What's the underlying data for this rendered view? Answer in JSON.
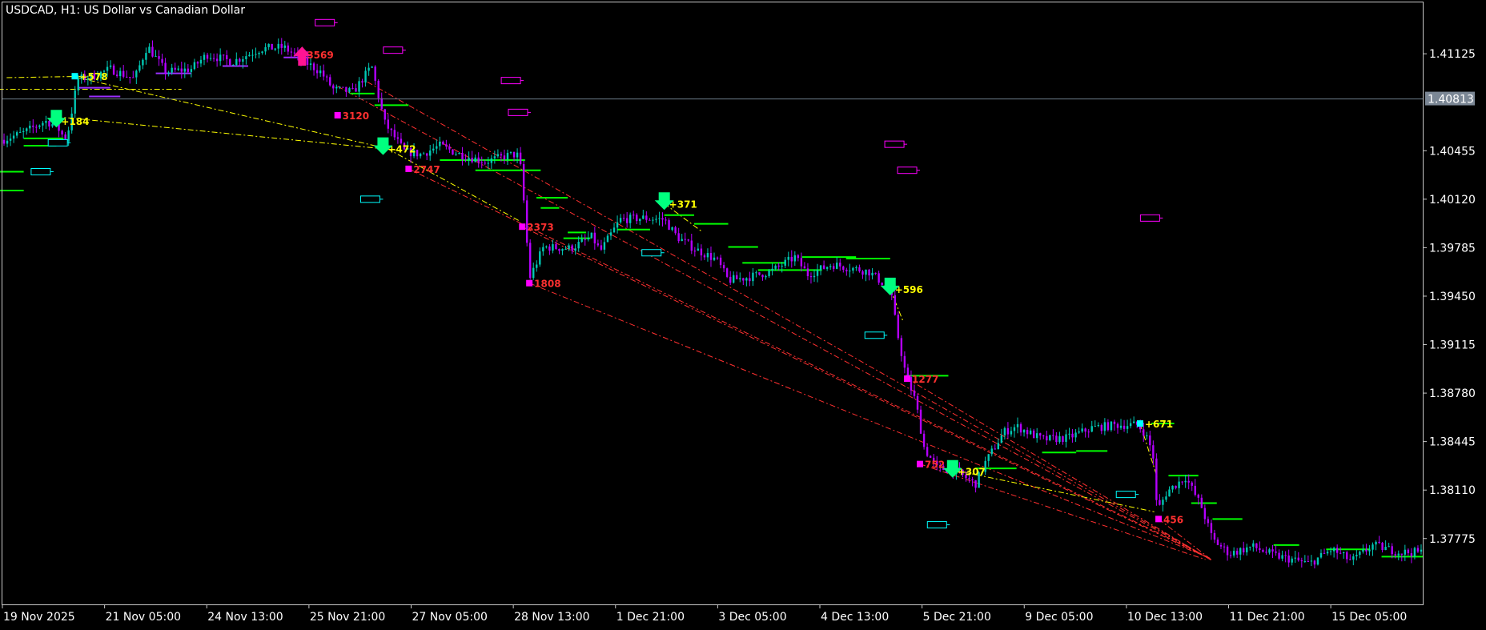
{
  "chart_data": {
    "type": "candlestick",
    "title": "USDCAD, H1:  US Dollar vs Canadian Dollar",
    "symbol": "USDCAD",
    "timeframe": "H1",
    "description": "US Dollar vs Canadian Dollar",
    "ylim": [
      1.3732,
      1.4148
    ],
    "grid": false,
    "current_price": "1.40813",
    "y_ticks": [
      "1.41125",
      "1.40455",
      "1.40120",
      "1.39785",
      "1.39450",
      "1.39115",
      "1.38780",
      "1.38445",
      "1.38110",
      "1.37775"
    ],
    "x_ticks": [
      "19 Nov 2025",
      "21 Nov 05:00",
      "24 Nov 13:00",
      "25 Nov 21:00",
      "27 Nov 05:00",
      "28 Nov 13:00",
      "1 Dec 21:00",
      "3 Dec 05:00",
      "4 Dec 13:00",
      "5 Dec 21:00",
      "9 Dec 05:00",
      "10 Dec 13:00",
      "11 Dec 21:00",
      "15 Dec 05:00"
    ],
    "x_range": [
      0,
      100
    ],
    "price_path": [
      [
        0,
        1.4053
      ],
      [
        1.5,
        1.4058
      ],
      [
        3,
        1.4066
      ],
      [
        3.8,
        1.4063
      ],
      [
        4.5,
        1.4052
      ],
      [
        5.3,
        1.4095
      ],
      [
        6.4,
        1.4097
      ],
      [
        7.6,
        1.4102
      ],
      [
        9.3,
        1.4095
      ],
      [
        10.2,
        1.4118
      ],
      [
        11.5,
        1.41
      ],
      [
        13.3,
        1.4102
      ],
      [
        14.4,
        1.4112
      ],
      [
        16.2,
        1.4107
      ],
      [
        18.2,
        1.4116
      ],
      [
        19.8,
        1.4117
      ],
      [
        21.6,
        1.4105
      ],
      [
        22.4,
        1.41
      ],
      [
        23.3,
        1.4088
      ],
      [
        24.7,
        1.4086
      ],
      [
        26,
        1.4104
      ],
      [
        26.9,
        1.4065
      ],
      [
        28.3,
        1.4045
      ],
      [
        29.5,
        1.4043
      ],
      [
        30.8,
        1.4049
      ],
      [
        32.2,
        1.4043
      ],
      [
        34,
        1.4038
      ],
      [
        35.9,
        1.4043
      ],
      [
        36.4,
        1.4042
      ],
      [
        36.8,
        1.4001
      ],
      [
        37.1,
        1.3957
      ],
      [
        38.1,
        1.3979
      ],
      [
        40,
        1.3978
      ],
      [
        41.5,
        1.3986
      ],
      [
        42.1,
        1.3976
      ],
      [
        43.5,
        1.3998
      ],
      [
        45.1,
        1.3999
      ],
      [
        46.6,
        1.3998
      ],
      [
        47.5,
        1.3986
      ],
      [
        48.7,
        1.3978
      ],
      [
        50.3,
        1.397
      ],
      [
        51.1,
        1.3956
      ],
      [
        52.5,
        1.3958
      ],
      [
        54.1,
        1.3962
      ],
      [
        55.8,
        1.3972
      ],
      [
        56.7,
        1.396
      ],
      [
        58.4,
        1.3967
      ],
      [
        61,
        1.3962
      ],
      [
        62.5,
        1.395
      ],
      [
        63,
        1.392
      ],
      [
        63.6,
        1.3891
      ],
      [
        64.3,
        1.3872
      ],
      [
        64.9,
        1.384
      ],
      [
        65.8,
        1.3826
      ],
      [
        67,
        1.3825
      ],
      [
        68.5,
        1.3815
      ],
      [
        69.2,
        1.383
      ],
      [
        70.5,
        1.3851
      ],
      [
        71.4,
        1.3855
      ],
      [
        73.2,
        1.3846
      ],
      [
        75,
        1.3847
      ],
      [
        76.7,
        1.3854
      ],
      [
        78.5,
        1.3856
      ],
      [
        79.9,
        1.3856
      ],
      [
        80.4,
        1.3851
      ],
      [
        81,
        1.3837
      ],
      [
        81.3,
        1.3796
      ],
      [
        82,
        1.381
      ],
      [
        83.3,
        1.382
      ],
      [
        84.4,
        1.38
      ],
      [
        85.2,
        1.3777
      ],
      [
        86.4,
        1.3767
      ],
      [
        88,
        1.3772
      ],
      [
        89.5,
        1.3766
      ],
      [
        90.8,
        1.3763
      ],
      [
        92,
        1.376
      ],
      [
        93.6,
        1.377
      ],
      [
        95,
        1.3762
      ],
      [
        96.5,
        1.3773
      ],
      [
        98.4,
        1.3768
      ],
      [
        100,
        1.3768
      ]
    ],
    "volatility": 0.0006,
    "signals": [
      {
        "label": "+578",
        "x": 5.1,
        "y": 1.4097,
        "kind": "entry",
        "color": "#ffff00"
      },
      {
        "label": "+184",
        "x": 3.8,
        "y": 1.4066,
        "kind": "down-arrow",
        "color": "#ffff00"
      },
      {
        "label": "3569",
        "x": 21.1,
        "y": 1.4112,
        "kind": "up-arrow",
        "color": "#ff3030"
      },
      {
        "label": "3120",
        "x": 23.6,
        "y": 1.407,
        "kind": "box",
        "color": "#ff3030"
      },
      {
        "label": "+472",
        "x": 26.8,
        "y": 1.4047,
        "kind": "down-arrow",
        "color": "#ffff00"
      },
      {
        "label": "2747",
        "x": 28.6,
        "y": 1.4033,
        "kind": "box",
        "color": "#ff3030"
      },
      {
        "label": "2373",
        "x": 36.6,
        "y": 1.3993,
        "kind": "box",
        "color": "#ff3030"
      },
      {
        "label": "1808",
        "x": 37.1,
        "y": 1.3954,
        "kind": "box",
        "color": "#ff3030"
      },
      {
        "label": "+371",
        "x": 46.6,
        "y": 1.4009,
        "kind": "down-arrow",
        "color": "#ffff00"
      },
      {
        "label": "+596",
        "x": 62.5,
        "y": 1.395,
        "kind": "down-arrow",
        "color": "#ffff00"
      },
      {
        "label": "1277",
        "x": 63.7,
        "y": 1.3888,
        "kind": "box",
        "color": "#ff3030"
      },
      {
        "label": "752",
        "x": 64.6,
        "y": 1.3829,
        "kind": "box",
        "color": "#ff3030"
      },
      {
        "label": "+307",
        "x": 66.9,
        "y": 1.3824,
        "kind": "down-arrow",
        "color": "#ffff00"
      },
      {
        "label": "+671",
        "x": 80.1,
        "y": 1.3857,
        "kind": "entry",
        "color": "#ffff00"
      },
      {
        "label": "456",
        "x": 81.4,
        "y": 1.3791,
        "kind": "box",
        "color": "#ff3030"
      }
    ],
    "level_segments": [
      {
        "x1": -0.2,
        "x2": 1.5,
        "y": 1.4031,
        "color": "#00ff00"
      },
      {
        "x1": -0.2,
        "x2": 1.5,
        "y": 1.4018,
        "color": "#00ff00"
      },
      {
        "x1": 1.5,
        "x2": 4.3,
        "y": 1.4054,
        "color": "#00ff00"
      },
      {
        "x1": 1.5,
        "x2": 3.8,
        "y": 1.4049,
        "color": "#00ff00"
      },
      {
        "x1": 5.3,
        "x2": 7.6,
        "y": 1.4089,
        "color": "#9b30ff"
      },
      {
        "x1": 6.1,
        "x2": 8.3,
        "y": 1.4083,
        "color": "#9b30ff"
      },
      {
        "x1": 10.8,
        "x2": 13.3,
        "y": 1.4099,
        "color": "#9b30ff"
      },
      {
        "x1": 15.5,
        "x2": 17.3,
        "y": 1.4104,
        "color": "#9b30ff"
      },
      {
        "x1": 19.8,
        "x2": 21.6,
        "y": 1.411,
        "color": "#9b30ff"
      },
      {
        "x1": 24.5,
        "x2": 26.2,
        "y": 1.4085,
        "color": "#00ff00"
      },
      {
        "x1": 26.2,
        "x2": 28.6,
        "y": 1.4077,
        "color": "#00ff00"
      },
      {
        "x1": 30.8,
        "x2": 36.8,
        "y": 1.4039,
        "color": "#00ff00"
      },
      {
        "x1": 33.3,
        "x2": 37.9,
        "y": 1.4032,
        "color": "#00ff00"
      },
      {
        "x1": 37.6,
        "x2": 39.8,
        "y": 1.4013,
        "color": "#00ff00"
      },
      {
        "x1": 37.9,
        "x2": 39.2,
        "y": 1.4006,
        "color": "#00ff00"
      },
      {
        "x1": 39.8,
        "x2": 41.1,
        "y": 1.3989,
        "color": "#00ff00"
      },
      {
        "x1": 39.5,
        "x2": 41.4,
        "y": 1.3985,
        "color": "#00ff00"
      },
      {
        "x1": 43.3,
        "x2": 45.6,
        "y": 1.3991,
        "color": "#00ff00"
      },
      {
        "x1": 46.6,
        "x2": 48.7,
        "y": 1.4001,
        "color": "#00ff00"
      },
      {
        "x1": 48.7,
        "x2": 51.1,
        "y": 1.3995,
        "color": "#00ff00"
      },
      {
        "x1": 51.1,
        "x2": 53.2,
        "y": 1.3979,
        "color": "#00ff00"
      },
      {
        "x1": 52.1,
        "x2": 55.1,
        "y": 1.3968,
        "color": "#00ff00"
      },
      {
        "x1": 53.2,
        "x2": 57.7,
        "y": 1.3963,
        "color": "#00ff00"
      },
      {
        "x1": 56.3,
        "x2": 60.1,
        "y": 1.3972,
        "color": "#00ff00"
      },
      {
        "x1": 59.4,
        "x2": 62.5,
        "y": 1.3971,
        "color": "#00ff00"
      },
      {
        "x1": 63.6,
        "x2": 66.6,
        "y": 1.389,
        "color": "#00ff00"
      },
      {
        "x1": 68.5,
        "x2": 71.4,
        "y": 1.3826,
        "color": "#00ff00"
      },
      {
        "x1": 73.2,
        "x2": 75.6,
        "y": 1.3837,
        "color": "#00ff00"
      },
      {
        "x1": 75.6,
        "x2": 77.8,
        "y": 1.3838,
        "color": "#00ff00"
      },
      {
        "x1": 80.9,
        "x2": 82.5,
        "y": 1.3857,
        "color": "#00ff00"
      },
      {
        "x1": 82.1,
        "x2": 84.2,
        "y": 1.3821,
        "color": "#00ff00"
      },
      {
        "x1": 83.7,
        "x2": 85.5,
        "y": 1.3802,
        "color": "#00ff00"
      },
      {
        "x1": 85.2,
        "x2": 87.3,
        "y": 1.3791,
        "color": "#00ff00"
      },
      {
        "x1": 89.5,
        "x2": 91.3,
        "y": 1.3773,
        "color": "#00ff00"
      },
      {
        "x1": 93.2,
        "x2": 96.3,
        "y": 1.377,
        "color": "#00ff00"
      },
      {
        "x1": 97.1,
        "x2": 100,
        "y": 1.3765,
        "color": "#00ff00"
      }
    ],
    "dashed_lines": [
      {
        "x1": 23.6,
        "y1": 1.409,
        "x2": 85.1,
        "y2": 1.3763,
        "color": "#ff3030"
      },
      {
        "x1": 25.7,
        "y1": 1.4093,
        "x2": 85.1,
        "y2": 1.3763,
        "color": "#ff3030"
      },
      {
        "x1": 28.6,
        "y1": 1.4033,
        "x2": 84.8,
        "y2": 1.3765,
        "color": "#ff3030"
      },
      {
        "x1": 36.6,
        "y1": 1.3993,
        "x2": 84.9,
        "y2": 1.3764,
        "color": "#ff3030"
      },
      {
        "x1": 37.1,
        "y1": 1.3954,
        "x2": 85.0,
        "y2": 1.3764,
        "color": "#ff3030"
      },
      {
        "x1": 63.7,
        "y1": 1.3888,
        "x2": 85.2,
        "y2": 1.3762,
        "color": "#ff3030"
      },
      {
        "x1": 64.6,
        "y1": 1.3829,
        "x2": 84.7,
        "y2": 1.3763,
        "color": "#ff3030"
      },
      {
        "x1": 81.4,
        "y1": 1.3791,
        "x2": 85.1,
        "y2": 1.3763,
        "color": "#ff3030"
      },
      {
        "x1": -0.3,
        "y1": 1.4088,
        "x2": 12.6,
        "y2": 1.4088,
        "color": "#ffff00"
      },
      {
        "x1": 0.3,
        "y1": 1.4096,
        "x2": 6.2,
        "y2": 1.4097,
        "color": "#ffff00"
      },
      {
        "x1": 3.8,
        "y1": 1.4069,
        "x2": 27.7,
        "y2": 1.4046,
        "color": "#ffff00"
      },
      {
        "x1": 5.3,
        "y1": 1.4096,
        "x2": 27.1,
        "y2": 1.4047,
        "color": "#ffff00"
      },
      {
        "x1": 27.1,
        "y1": 1.4047,
        "x2": 36.4,
        "y2": 1.3997,
        "color": "#ffff00"
      },
      {
        "x1": 46.6,
        "y1": 1.4009,
        "x2": 49.2,
        "y2": 1.399,
        "color": "#ffff00"
      },
      {
        "x1": 62.5,
        "y1": 1.395,
        "x2": 63.4,
        "y2": 1.3928,
        "color": "#ffff00"
      },
      {
        "x1": 66.9,
        "y1": 1.3825,
        "x2": 81.1,
        "y2": 1.3796,
        "color": "#ffff00"
      },
      {
        "x1": 80.1,
        "y1": 1.3857,
        "x2": 81.3,
        "y2": 1.382,
        "color": "#ffff00"
      }
    ],
    "tags": [
      {
        "x": 22.7,
        "y": 1.4134,
        "color": "#ff00ff"
      },
      {
        "x": 27.5,
        "y": 1.4115,
        "color": "#ff00ff"
      },
      {
        "x": 35.8,
        "y": 1.4094,
        "color": "#ff00ff"
      },
      {
        "x": 36.3,
        "y": 1.4072,
        "color": "#ff00ff"
      },
      {
        "x": 62.8,
        "y": 1.405,
        "color": "#ff00ff"
      },
      {
        "x": 63.7,
        "y": 1.4032,
        "color": "#ff00ff"
      },
      {
        "x": 80.8,
        "y": 1.3999,
        "color": "#ff00ff"
      },
      {
        "x": 3.9,
        "y": 1.4051,
        "color": "#00ffff"
      },
      {
        "x": 2.7,
        "y": 1.4031,
        "color": "#00ffff"
      },
      {
        "x": 25.9,
        "y": 1.4012,
        "color": "#00ffff"
      },
      {
        "x": 45.7,
        "y": 1.3975,
        "color": "#00ffff"
      },
      {
        "x": 61.4,
        "y": 1.3918,
        "color": "#00ffff"
      },
      {
        "x": 65.8,
        "y": 1.3787,
        "color": "#00ffff"
      },
      {
        "x": 79.1,
        "y": 1.3808,
        "color": "#00ffff"
      }
    ]
  }
}
